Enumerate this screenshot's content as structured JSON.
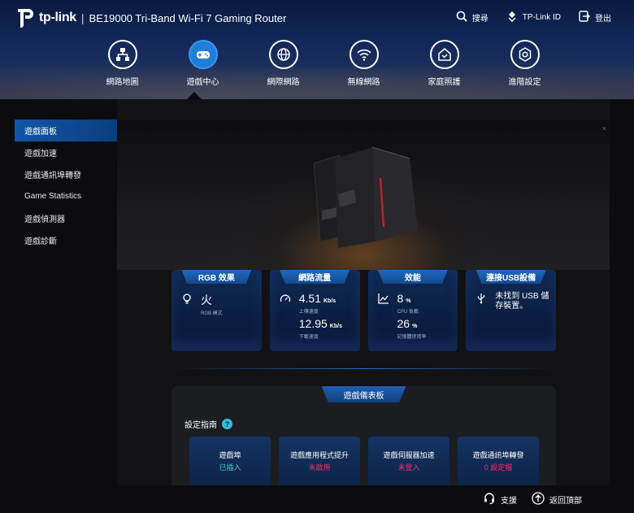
{
  "header": {
    "logo_text": "tp-link",
    "separator": "|",
    "product": "BE19000 Tri-Band Wi-Fi 7 Gaming Router",
    "actions": [
      {
        "label": "搜尋",
        "icon": "search-icon"
      },
      {
        "label": "TP-Link ID",
        "icon": "tplink-id-icon"
      },
      {
        "label": "登出",
        "icon": "logout-icon"
      }
    ]
  },
  "nav": [
    {
      "label": "網路地圖",
      "icon": "network-map-icon",
      "active": false
    },
    {
      "label": "遊戲中心",
      "icon": "gamepad-icon",
      "active": true
    },
    {
      "label": "網際網路",
      "icon": "globe-icon",
      "active": false
    },
    {
      "label": "無線網路",
      "icon": "wifi-icon",
      "active": false
    },
    {
      "label": "家庭照護",
      "icon": "home-care-icon",
      "active": false
    },
    {
      "label": "進階設定",
      "icon": "gear-icon",
      "active": false
    }
  ],
  "sidebar": {
    "items": [
      {
        "label": "遊戲面板",
        "active": true
      },
      {
        "label": "遊戲加速",
        "active": false
      },
      {
        "label": "遊戲通訊埠轉發",
        "active": false
      },
      {
        "label": "Game Statistics",
        "active": false
      },
      {
        "label": "遊戲偵測器",
        "active": false
      },
      {
        "label": "遊戲診斷",
        "active": false
      }
    ]
  },
  "hero": {
    "close": "×"
  },
  "cards": {
    "rgb": {
      "title": "RGB 效果",
      "value": "火",
      "sub": "RGB 模式"
    },
    "traffic": {
      "title": "網路流量",
      "up_value": "4.51",
      "up_unit": "Kb/s",
      "up_label": "上傳速度",
      "down_value": "12.95",
      "down_unit": "Kb/s",
      "down_label": "下載速度"
    },
    "perf": {
      "title": "效能",
      "cpu_value": "8",
      "cpu_unit": "%",
      "cpu_label": "CPU 負載",
      "mem_value": "26",
      "mem_unit": "%",
      "mem_label": "記憶體使用率"
    },
    "usb": {
      "title": "連接USB設備",
      "text": "未找到 USB 儲存裝置。"
    }
  },
  "panel": {
    "title": "遊戲儀表板",
    "guide": "設定指南",
    "help": "?",
    "steps": [
      {
        "title": "遊戲埠",
        "status": "已插入",
        "state": "ok"
      },
      {
        "title": "遊戲應用程式提升",
        "status": "未啟用",
        "state": "bad"
      },
      {
        "title": "遊戲伺服器加速",
        "status": "未登入",
        "state": "bad"
      },
      {
        "title": "遊戲通訊埠轉發",
        "status": "0 設定檔",
        "state": "bad"
      }
    ]
  },
  "footer": {
    "support": "支援",
    "back_top": "返回頂部"
  },
  "colors": {
    "accent": "#1f7fd6",
    "ok": "#3fd7c2",
    "warn": "#ff2a6a"
  }
}
